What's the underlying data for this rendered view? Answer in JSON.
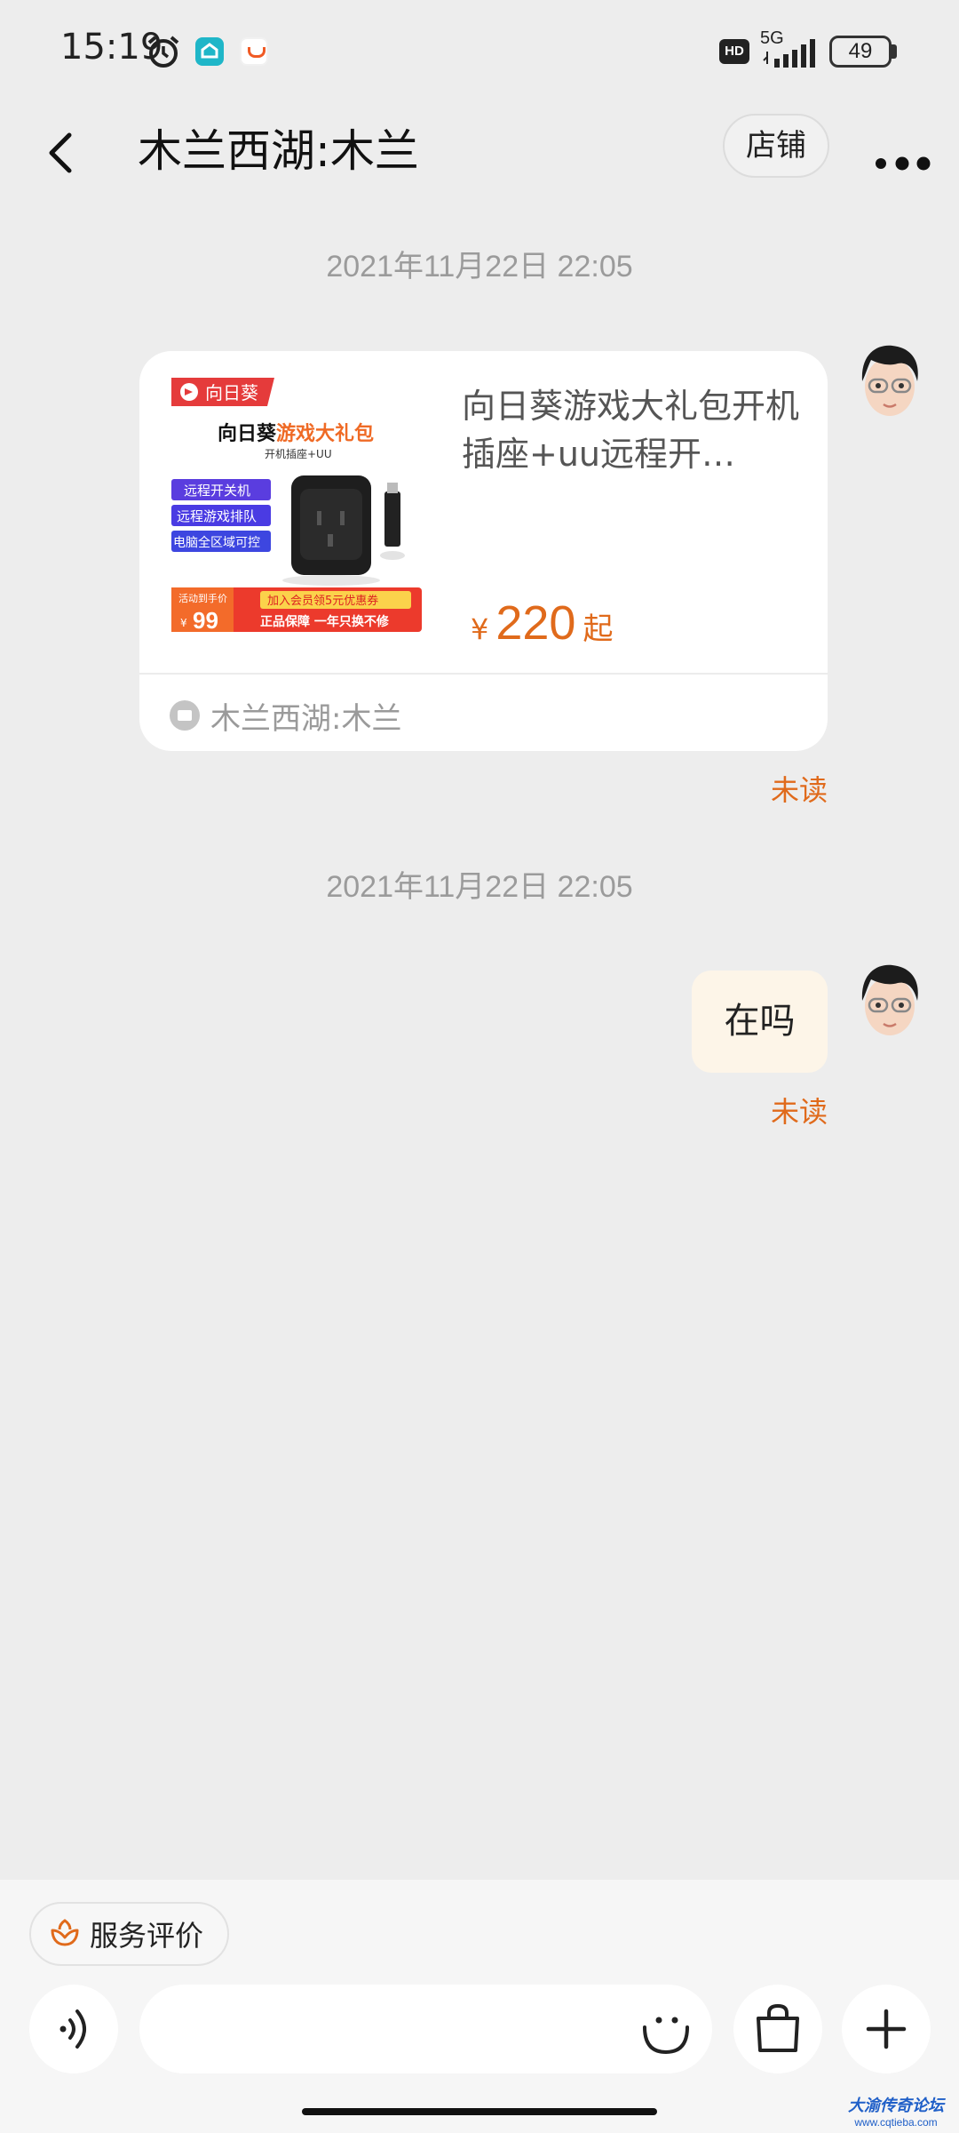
{
  "status_bar": {
    "time": "15:19",
    "hd": "HD",
    "network": "5G",
    "battery": "49"
  },
  "header": {
    "title": "木兰西湖:木兰",
    "shop_button": "店铺"
  },
  "messages": [
    {
      "timestamp": "2021年11月22日 22:05",
      "product": {
        "title": "向日葵游戏大礼包开机插座+uu远程开…",
        "price_symbol": "¥",
        "price": "220",
        "price_suffix": "起",
        "image": {
          "brand": "向日葵",
          "headline_black": "向日葵",
          "headline_orange": "游戏大礼包",
          "subline": "开机插座+UU",
          "features": [
            "远程开关机",
            "远程游戏排队",
            "电脑全区域可控"
          ],
          "promo_small": "活动到手价",
          "promo_price": "99",
          "promo_line1": "加入会员领5元优惠券",
          "promo_line2": "正品保障 一年只换不修"
        },
        "shop_name": "木兰西湖:木兰"
      },
      "status": "未读"
    },
    {
      "timestamp": "2021年11月22日 22:05",
      "text": "在吗",
      "status": "未读"
    }
  ],
  "bottom": {
    "service_rate": "服务评价",
    "input_placeholder": ""
  },
  "watermark": {
    "title": "大渝传奇论坛",
    "url": "www.cqtieba.com"
  },
  "colors": {
    "accent": "#e06a1b",
    "background": "#ededed",
    "bubble": "#fdf5e8"
  }
}
